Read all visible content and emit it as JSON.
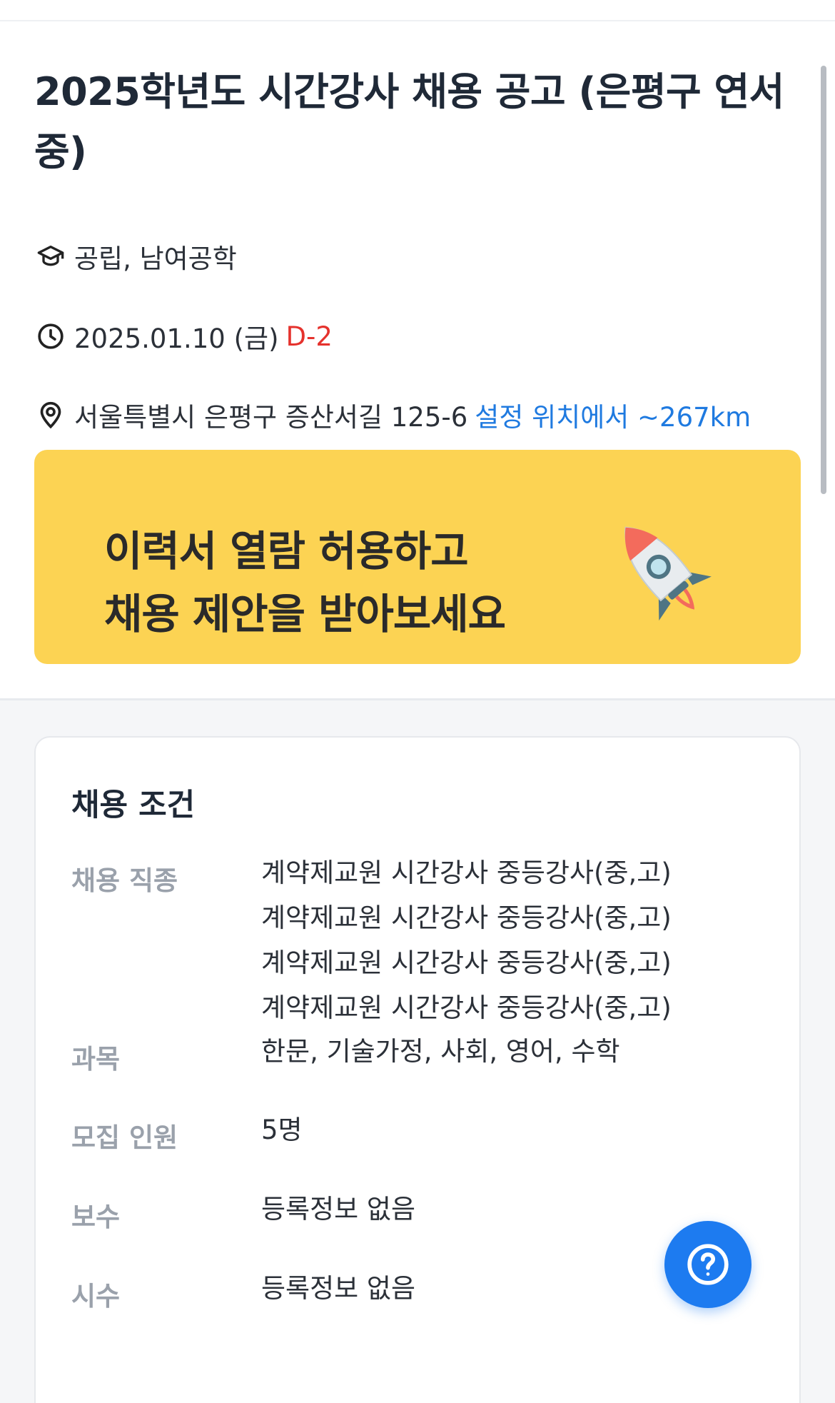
{
  "job": {
    "title": "2025학년도 시간강사 채용 공고 (은평구 연서중)",
    "school_type": "공립, 남여공학",
    "deadline": "2025.01.10 (금)",
    "dday": "D-2",
    "address": "서울특별시 은평구 증산서길 125-6",
    "distance": "설정 위치에서 ~267km"
  },
  "banner": {
    "line1": "이력서 열람 허용하고",
    "line2": "채용 제안을 받아보세요",
    "icon": "rocket-icon"
  },
  "conditions": {
    "title": "채용 조건",
    "job_type_label": "채용 직종",
    "job_types": [
      "계약제교원 시간강사  중등강사(중,고)",
      "계약제교원 시간강사  중등강사(중,고)",
      "계약제교원 시간강사  중등강사(중,고)",
      "계약제교원 시간강사  중등강사(중,고)"
    ],
    "subject_label": "과목",
    "subjects": "한문, 기술가정, 사회, 영어, 수학",
    "headcount_label": "모집 인원",
    "headcount": "5명",
    "pay_label": "보수",
    "pay": "등록정보 없음",
    "hours_label": "시수",
    "hours": "등록정보 없음"
  },
  "colors": {
    "dday": "#e5322d",
    "distance": "#1f7ae0",
    "banner": "#fcd353",
    "help_button": "#1d7bf0"
  },
  "icons": {
    "school": "graduation-cap-icon",
    "clock": "clock-icon",
    "location": "location-pin-icon",
    "help": "question-circle-icon"
  }
}
